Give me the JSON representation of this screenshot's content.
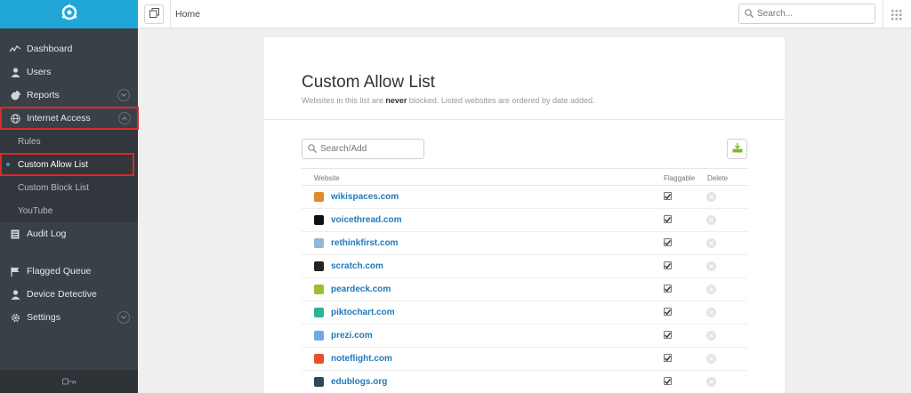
{
  "colors": {
    "accent": "#20a7d8",
    "sidebar": "#3a4047",
    "highlight": "#d62b2b",
    "link": "#1f7ab8"
  },
  "sidebar": {
    "items": [
      {
        "label": "Dashboard",
        "icon": "activity-icon"
      },
      {
        "label": "Users",
        "icon": "user-icon"
      },
      {
        "label": "Reports",
        "icon": "pie-chart-icon",
        "expandable": true
      },
      {
        "label": "Internet Access",
        "icon": "globe-icon",
        "expandable": true,
        "expanded": true
      },
      {
        "label": "Audit Log",
        "icon": "document-icon"
      },
      {
        "label": "Flagged Queue",
        "icon": "flag-icon"
      },
      {
        "label": "Device Detective",
        "icon": "user-search-icon"
      },
      {
        "label": "Settings",
        "icon": "gear-icon",
        "expandable": true
      }
    ],
    "subitems": [
      {
        "label": "Rules"
      },
      {
        "label": "Custom Allow List",
        "active": true
      },
      {
        "label": "Custom Block List"
      },
      {
        "label": "YouTube"
      }
    ]
  },
  "topbar": {
    "breadcrumb": "Home",
    "search_placeholder": "Search..."
  },
  "main": {
    "title": "Custom Allow List",
    "description_before": "Websites in this list are ",
    "description_bold": "never",
    "description_after": " blocked. Listed websites are ordered by date added.",
    "search_placeholder": "Search/Add",
    "columns": [
      "Website",
      "Flaggable",
      "Delete"
    ],
    "rows": [
      {
        "site": "wikispaces.com",
        "fav_color": "#e08a2a",
        "flaggable": true
      },
      {
        "site": "voicethread.com",
        "fav_color": "#111111",
        "flaggable": true
      },
      {
        "site": "rethinkfirst.com",
        "fav_color": "#8fb8d8",
        "flaggable": true
      },
      {
        "site": "scratch.com",
        "fav_color": "#222222",
        "flaggable": true
      },
      {
        "site": "peardeck.com",
        "fav_color": "#9bbf2e",
        "flaggable": true
      },
      {
        "site": "piktochart.com",
        "fav_color": "#2bb39a",
        "flaggable": true
      },
      {
        "site": "prezi.com",
        "fav_color": "#6fa8e6",
        "flaggable": true
      },
      {
        "site": "noteflight.com",
        "fav_color": "#e8502a",
        "flaggable": true
      },
      {
        "site": "edublogs.org",
        "fav_color": "#2d4a5a",
        "flaggable": true
      }
    ]
  }
}
